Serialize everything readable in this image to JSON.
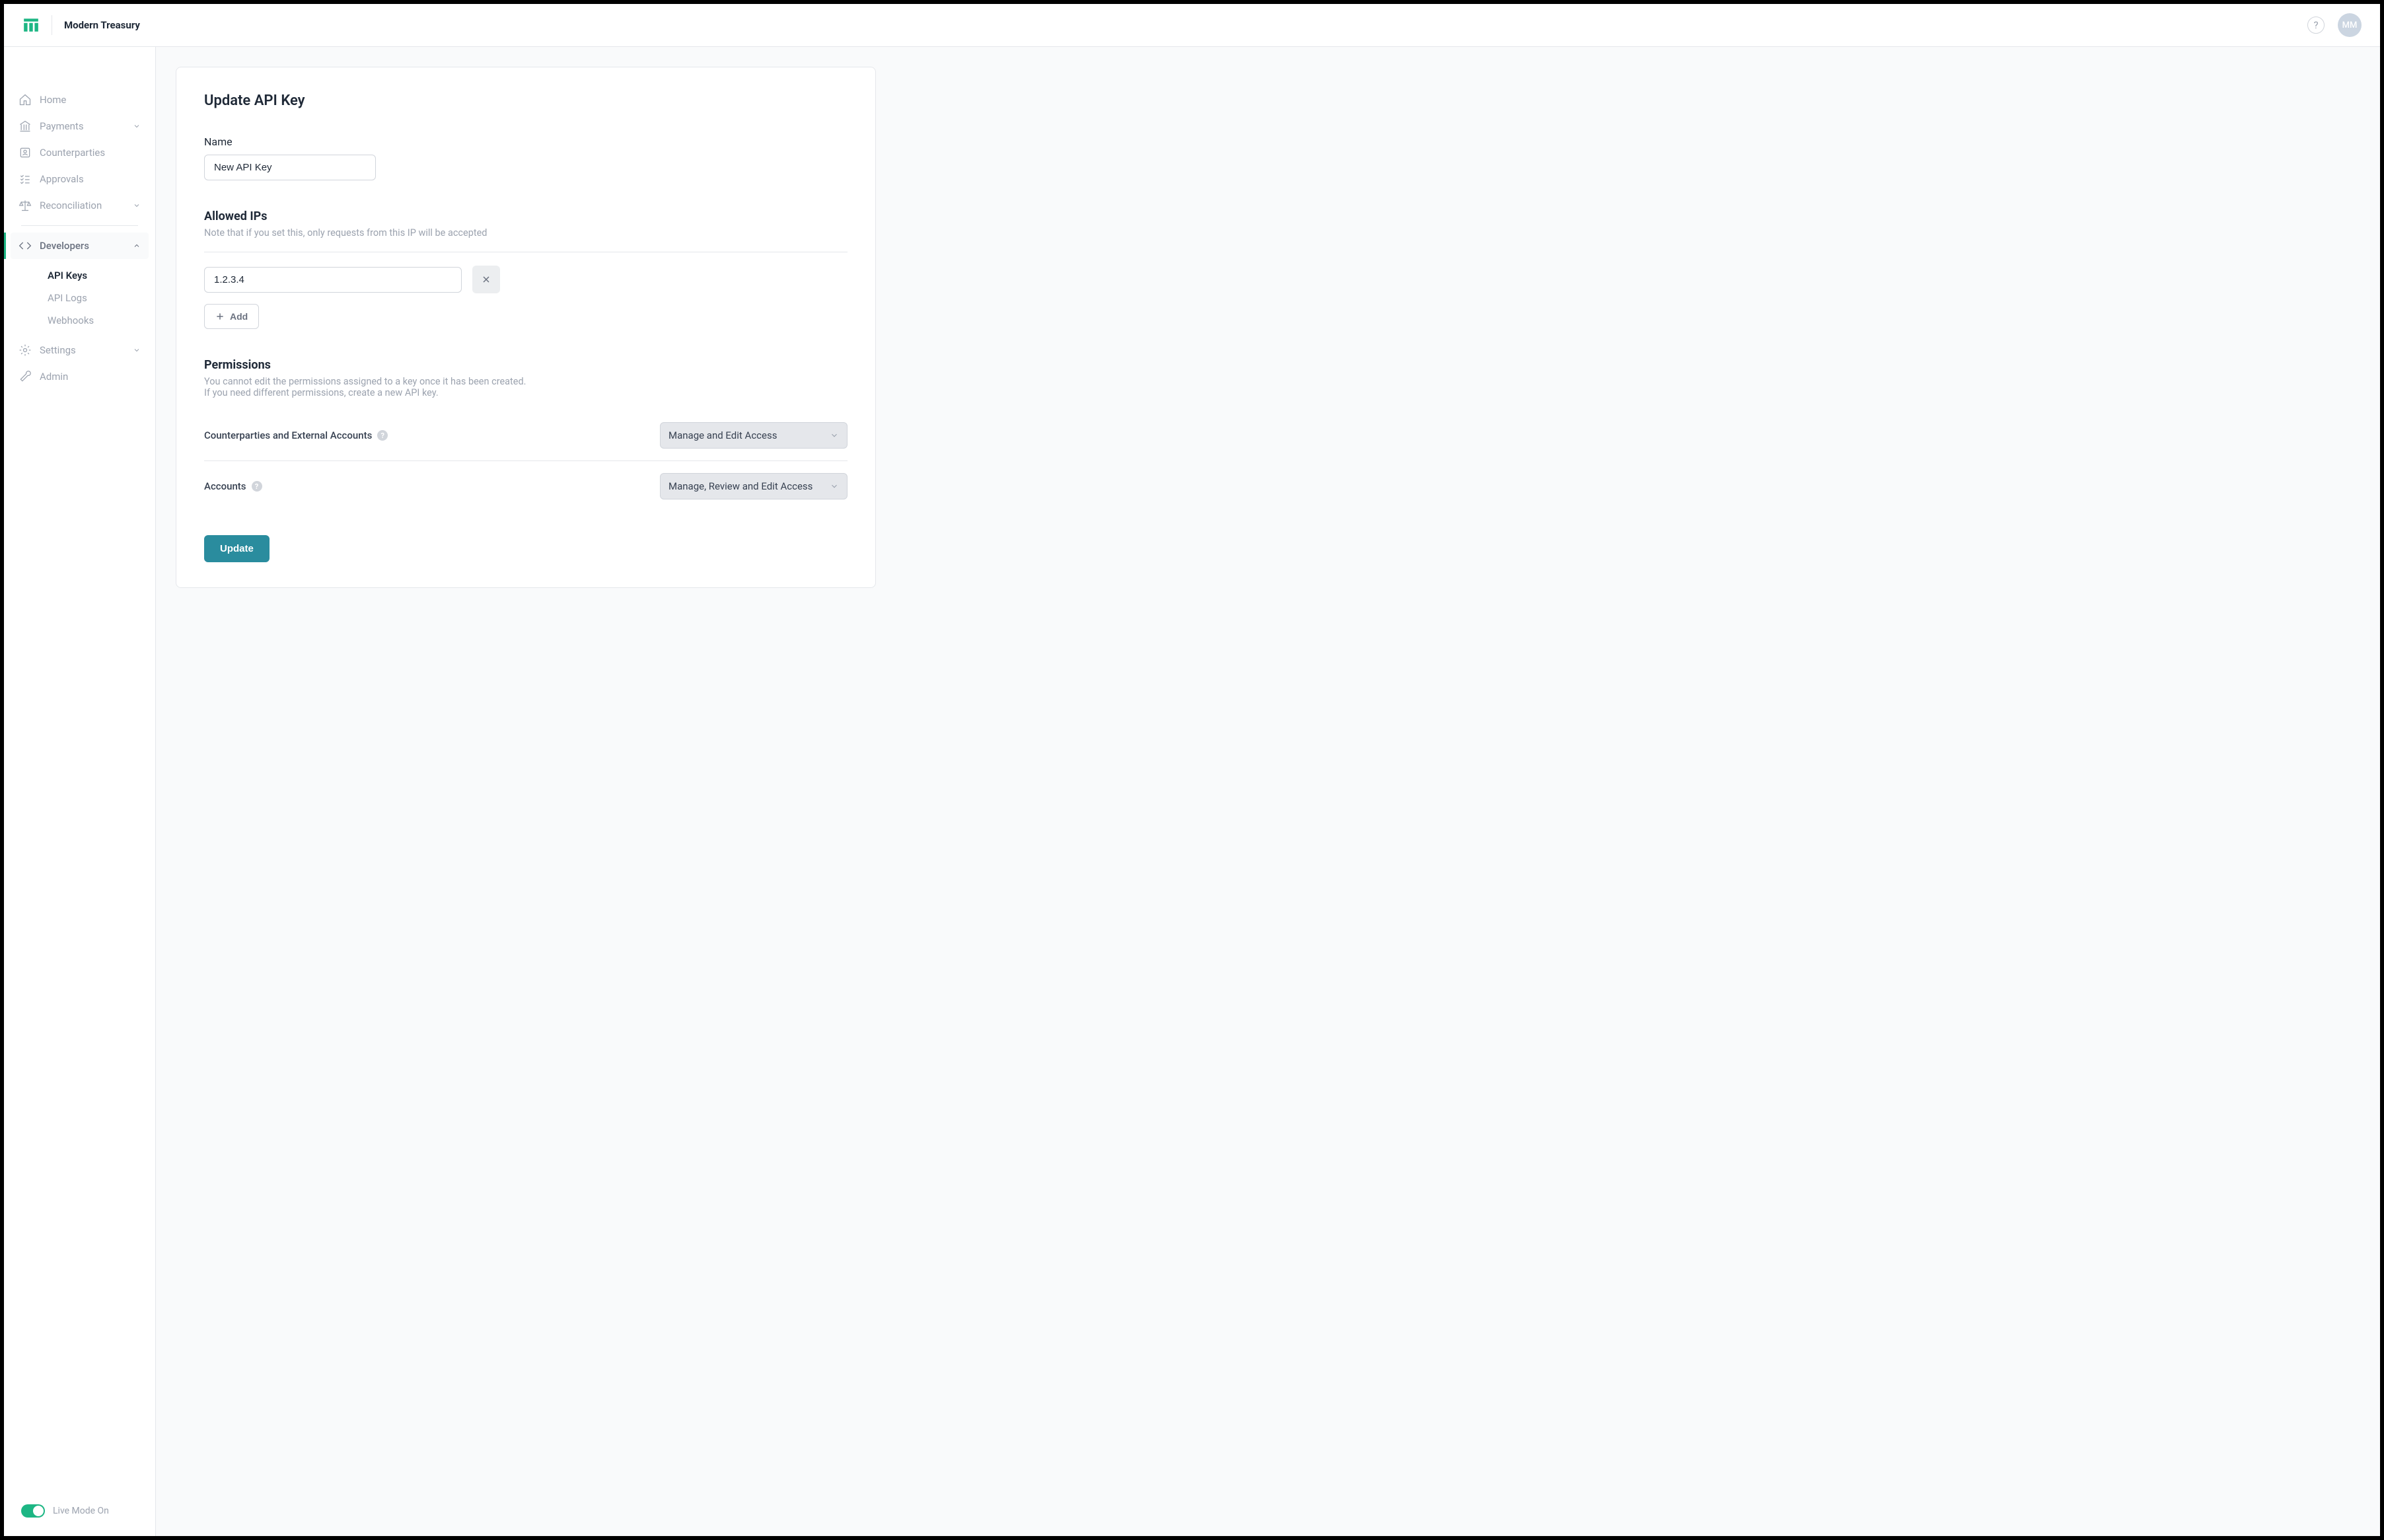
{
  "header": {
    "brand": "Modern Treasury",
    "avatar_initials": "MM"
  },
  "sidebar": {
    "items": [
      {
        "key": "home",
        "label": "Home"
      },
      {
        "key": "payments",
        "label": "Payments"
      },
      {
        "key": "counterparties",
        "label": "Counterparties"
      },
      {
        "key": "approvals",
        "label": "Approvals"
      },
      {
        "key": "reconciliation",
        "label": "Reconciliation"
      }
    ],
    "developers": {
      "label": "Developers",
      "children": [
        {
          "key": "api-keys",
          "label": "API Keys"
        },
        {
          "key": "api-logs",
          "label": "API Logs"
        },
        {
          "key": "webhooks",
          "label": "Webhooks"
        }
      ]
    },
    "settings_label": "Settings",
    "admin_label": "Admin",
    "live_mode_label": "Live Mode On"
  },
  "main": {
    "page_title": "Update API Key",
    "name_label": "Name",
    "name_value": "New API Key",
    "allowed_ips_title": "Allowed IPs",
    "allowed_ips_note": "Note that if you set this, only requests from this IP will be accepted",
    "ip_value": "1.2.3.4",
    "add_label": "Add",
    "permissions_title": "Permissions",
    "permissions_note_line1": "You cannot edit the permissions assigned to a key once it has been created.",
    "permissions_note_line2": "If you need different permissions, create a new API key.",
    "perm_rows": [
      {
        "label": "Counterparties and External Accounts",
        "value": "Manage and Edit Access"
      },
      {
        "label": "Accounts",
        "value": "Manage, Review and Edit Access"
      }
    ],
    "update_label": "Update"
  }
}
